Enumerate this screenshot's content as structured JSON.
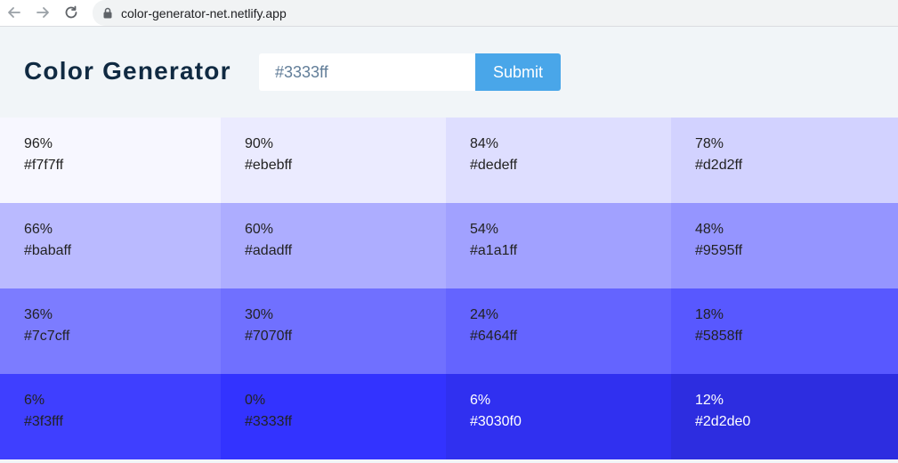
{
  "browser": {
    "url": "color-generator-net.netlify.app",
    "icons": [
      "back-arrow-icon",
      "forward-arrow-icon",
      "reload-icon",
      "lock-icon"
    ]
  },
  "app": {
    "title": "Color Generator",
    "input_placeholder": "#3333ff",
    "submit_label": "Submit",
    "colors": {
      "title": "#102a42",
      "input_text": "#617d98",
      "submit_bg": "#49a6e9",
      "header_bg": "#f1f5f8"
    }
  },
  "swatches": [
    {
      "pct": "96%",
      "hex": "#f7f7ff",
      "color": "#f7f7ff",
      "text": "dark"
    },
    {
      "pct": "90%",
      "hex": "#ebebff",
      "color": "#ebebff",
      "text": "dark"
    },
    {
      "pct": "84%",
      "hex": "#dedeff",
      "color": "#dedeff",
      "text": "dark"
    },
    {
      "pct": "78%",
      "hex": "#d2d2ff",
      "color": "#d2d2ff",
      "text": "dark"
    },
    {
      "pct": "66%",
      "hex": "#babaff",
      "color": "#babaff",
      "text": "dark"
    },
    {
      "pct": "60%",
      "hex": "#adadff",
      "color": "#adadff",
      "text": "dark"
    },
    {
      "pct": "54%",
      "hex": "#a1a1ff",
      "color": "#a1a1ff",
      "text": "dark"
    },
    {
      "pct": "48%",
      "hex": "#9595ff",
      "color": "#9595ff",
      "text": "dark"
    },
    {
      "pct": "36%",
      "hex": "#7c7cff",
      "color": "#7c7cff",
      "text": "dark"
    },
    {
      "pct": "30%",
      "hex": "#7070ff",
      "color": "#7070ff",
      "text": "dark"
    },
    {
      "pct": "24%",
      "hex": "#6464ff",
      "color": "#6464ff",
      "text": "dark"
    },
    {
      "pct": "18%",
      "hex": "#5858ff",
      "color": "#5858ff",
      "text": "dark"
    },
    {
      "pct": "6%",
      "hex": "#3f3fff",
      "color": "#3f3fff",
      "text": "dark"
    },
    {
      "pct": "0%",
      "hex": "#3333ff",
      "color": "#3333ff",
      "text": "dark"
    },
    {
      "pct": "6%",
      "hex": "#3030f0",
      "color": "#3030f0",
      "text": "light"
    },
    {
      "pct": "12%",
      "hex": "#2d2de0",
      "color": "#2d2de0",
      "text": "light"
    }
  ]
}
